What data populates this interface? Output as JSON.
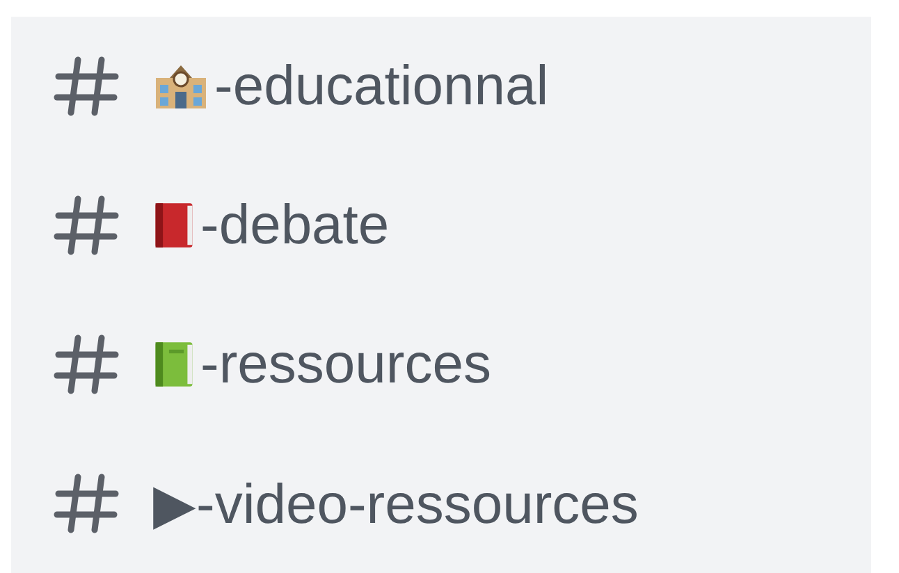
{
  "channels": [
    {
      "kind": "school",
      "name": "-educationnal"
    },
    {
      "kind": "red-book",
      "name": "-debate"
    },
    {
      "kind": "green-book",
      "name": "-ressources"
    },
    {
      "kind": "plain",
      "name": "▶-video-ressources"
    }
  ]
}
